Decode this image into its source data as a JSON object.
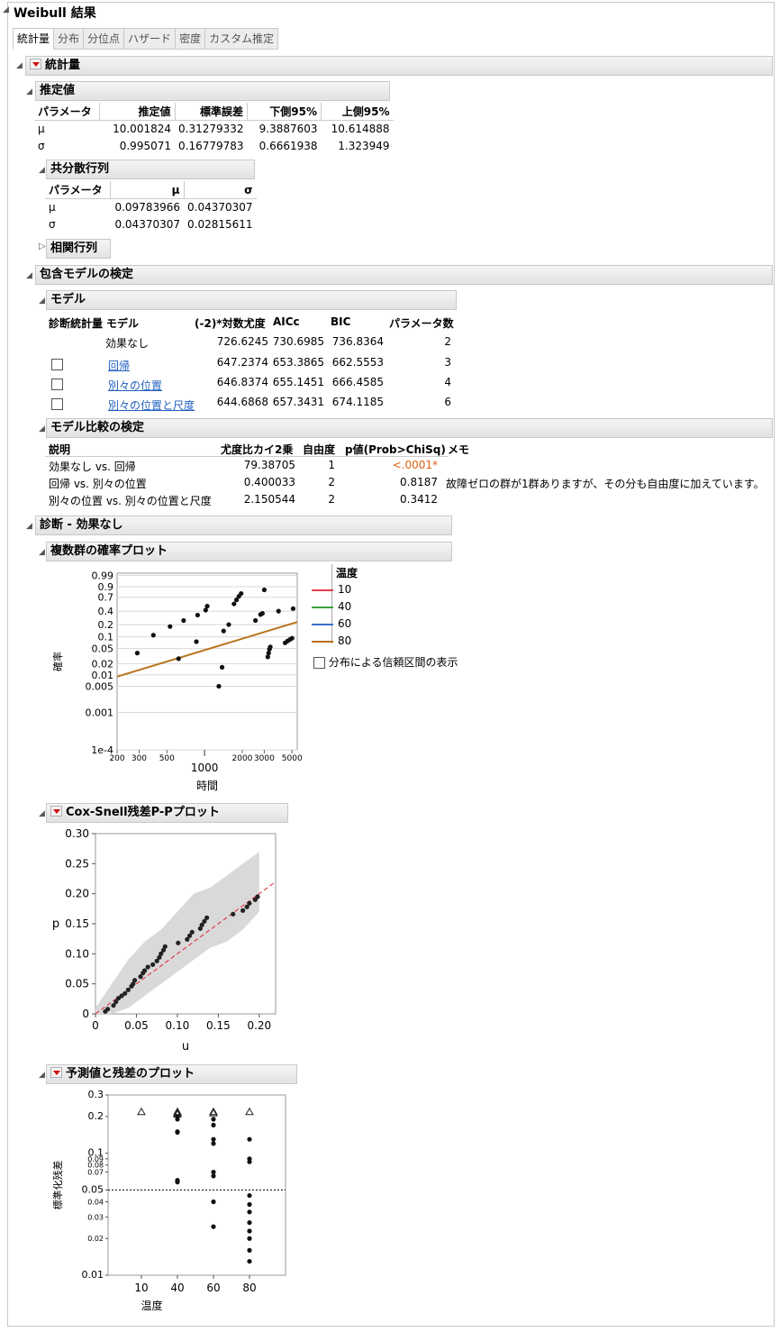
{
  "window": {
    "title": "Weibull 結果"
  },
  "tabs": [
    "統計量",
    "分布",
    "分位点",
    "ハザード",
    "密度",
    "カスタム推定"
  ],
  "statistics": {
    "title": "統計量",
    "estimates": {
      "title": "推定値",
      "headers": [
        "パラメータ",
        "推定値",
        "標準誤差",
        "下側95%",
        "上側95%"
      ],
      "rows": [
        [
          "μ",
          "10.001824",
          "0.31279332",
          "9.3887603",
          "10.614888"
        ],
        [
          "σ",
          "0.995071",
          "0.16779783",
          "0.6661938",
          "1.323949"
        ]
      ]
    },
    "covariance": {
      "title": "共分散行列",
      "headers": [
        "パラメータ",
        "μ",
        "σ"
      ],
      "rows": [
        [
          "μ",
          "0.09783966",
          "0.04370307"
        ],
        [
          "σ",
          "0.04370307",
          "0.02815611"
        ]
      ]
    },
    "correlation": {
      "title": "相関行列"
    }
  },
  "nested": {
    "title": "包含モデルの検定",
    "model": {
      "title": "モデル",
      "headers": [
        "診断統計量",
        "モデル",
        "(-2)*対数尤度",
        "AICc",
        "BIC",
        "パラメータ数"
      ],
      "rows": [
        {
          "name": "効果なし",
          "link": false,
          "ll": "726.6245",
          "aicc": "730.6985",
          "bic": "736.8364",
          "k": "2"
        },
        {
          "name": "回帰",
          "link": true,
          "ll": "647.2374",
          "aicc": "653.3865",
          "bic": "662.5553",
          "k": "3"
        },
        {
          "name": "別々の位置",
          "link": true,
          "ll": "646.8374",
          "aicc": "655.1451",
          "bic": "666.4585",
          "k": "4"
        },
        {
          "name": "別々の位置と尺度",
          "link": true,
          "ll": "644.6868",
          "aicc": "657.3431",
          "bic": "674.1185",
          "k": "6"
        }
      ]
    },
    "comparison": {
      "title": "モデル比較の検定",
      "headers": [
        "説明",
        "尤度比カイ2乗",
        "自由度",
        "p値(Prob>ChiSq)",
        "メモ"
      ],
      "rows": [
        [
          "効果なし vs. 回帰",
          "79.38705",
          "1",
          "<.0001*",
          ""
        ],
        [
          "回帰 vs. 別々の位置",
          "0.400033",
          "2",
          "0.8187",
          "故障ゼロの群が1群ありますが、その分も自由度に加えています。"
        ],
        [
          "別々の位置 vs. 別々の位置と尺度",
          "2.150544",
          "2",
          "0.3412",
          ""
        ]
      ]
    }
  },
  "diagnostics": {
    "title": "診断 - 効果なし",
    "prob_plot": {
      "title": "複数群の確率プロット",
      "xlabel": "時間",
      "ylabel": "確率",
      "legend_title": "温度",
      "legend": [
        {
          "label": "10",
          "color": "#e0404a"
        },
        {
          "label": "40",
          "color": "#3aa03a"
        },
        {
          "label": "60",
          "color": "#3a6fd0"
        },
        {
          "label": "80",
          "color": "#b8741a"
        }
      ],
      "checkbox_label": "分布による信頼区間の表示"
    },
    "coxsnell": {
      "title": "Cox-Snell残差P-Pプロット",
      "xlabel": "u",
      "ylabel": "p"
    },
    "residual": {
      "title": "予測値と残差のプロット",
      "xlabel": "温度",
      "ylabel": "標準化残差"
    }
  },
  "chart_data": [
    {
      "type": "scatter",
      "title": "複数群の確率プロット",
      "xlabel": "時間",
      "ylabel": "確率",
      "x_scale": "log",
      "x_ticks_minor": [
        "200",
        "300",
        "500",
        "2000",
        "3000",
        "5000"
      ],
      "x_ticks_major": [
        "1000"
      ],
      "xlim": [
        200,
        5500
      ],
      "y_scale": "weibull",
      "y_ticks": [
        "0.99",
        "0.9",
        "0.7",
        "0.4",
        "0.2",
        "0.1",
        "0.05",
        "0.02",
        "0.01",
        "0.005",
        "0.001",
        "1e-4"
      ],
      "line": {
        "name": "80",
        "x": [
          200,
          5500
        ],
        "y": [
          0.009,
          0.23
        ]
      },
      "points": [
        [
          290,
          0.038
        ],
        [
          390,
          0.11
        ],
        [
          530,
          0.18
        ],
        [
          620,
          0.027
        ],
        [
          680,
          0.25
        ],
        [
          860,
          0.075
        ],
        [
          880,
          0.33
        ],
        [
          1020,
          0.42
        ],
        [
          1050,
          0.5
        ],
        [
          1300,
          0.005
        ],
        [
          1380,
          0.016
        ],
        [
          1420,
          0.14
        ],
        [
          1560,
          0.2
        ],
        [
          1720,
          0.55
        ],
        [
          1800,
          0.64
        ],
        [
          1880,
          0.72
        ],
        [
          1960,
          0.78
        ],
        [
          2550,
          0.25
        ],
        [
          2800,
          0.34
        ],
        [
          2900,
          0.36
        ],
        [
          3000,
          0.85
        ],
        [
          3200,
          0.03
        ],
        [
          3250,
          0.038
        ],
        [
          3300,
          0.048
        ],
        [
          3350,
          0.055
        ],
        [
          3900,
          0.4
        ],
        [
          4400,
          0.07
        ],
        [
          4600,
          0.078
        ],
        [
          4800,
          0.085
        ],
        [
          5000,
          0.092
        ],
        [
          5100,
          0.45
        ]
      ],
      "legend_title": "温度",
      "legend": [
        "10",
        "40",
        "60",
        "80"
      ]
    },
    {
      "type": "scatter",
      "title": "Cox-Snell残差P-Pプロット",
      "xlabel": "u",
      "ylabel": "p",
      "xlim": [
        0,
        0.22
      ],
      "ylim": [
        0,
        0.3
      ],
      "x_ticks": [
        "0",
        "0.05",
        "0.10",
        "0.15",
        "0.20"
      ],
      "y_ticks": [
        "0",
        "0.05",
        "0.10",
        "0.15",
        "0.20",
        "0.25",
        "0.30"
      ],
      "reference_line": {
        "x": [
          0,
          0.22
        ],
        "y": [
          0,
          0.22
        ]
      },
      "band": {
        "x": [
          0.0,
          0.02,
          0.04,
          0.06,
          0.08,
          0.1,
          0.12,
          0.14,
          0.16,
          0.18,
          0.2
        ],
        "upper": [
          0.01,
          0.05,
          0.09,
          0.12,
          0.14,
          0.17,
          0.2,
          0.21,
          0.23,
          0.25,
          0.27
        ],
        "lower": [
          0.0,
          0.0,
          0.01,
          0.03,
          0.05,
          0.07,
          0.09,
          0.11,
          0.12,
          0.14,
          0.17
        ]
      },
      "points": [
        [
          0.012,
          0.004
        ],
        [
          0.015,
          0.008
        ],
        [
          0.022,
          0.014
        ],
        [
          0.025,
          0.02
        ],
        [
          0.028,
          0.026
        ],
        [
          0.032,
          0.03
        ],
        [
          0.036,
          0.034
        ],
        [
          0.04,
          0.04
        ],
        [
          0.044,
          0.046
        ],
        [
          0.046,
          0.05
        ],
        [
          0.048,
          0.056
        ],
        [
          0.055,
          0.062
        ],
        [
          0.058,
          0.068
        ],
        [
          0.06,
          0.072
        ],
        [
          0.064,
          0.078
        ],
        [
          0.07,
          0.082
        ],
        [
          0.075,
          0.088
        ],
        [
          0.078,
          0.094
        ],
        [
          0.08,
          0.1
        ],
        [
          0.083,
          0.106
        ],
        [
          0.085,
          0.112
        ],
        [
          0.101,
          0.118
        ],
        [
          0.112,
          0.124
        ],
        [
          0.115,
          0.13
        ],
        [
          0.118,
          0.136
        ],
        [
          0.128,
          0.142
        ],
        [
          0.13,
          0.148
        ],
        [
          0.133,
          0.154
        ],
        [
          0.136,
          0.16
        ],
        [
          0.168,
          0.166
        ],
        [
          0.18,
          0.172
        ],
        [
          0.185,
          0.178
        ],
        [
          0.188,
          0.184
        ],
        [
          0.195,
          0.19
        ],
        [
          0.198,
          0.195
        ]
      ]
    },
    {
      "type": "scatter",
      "title": "予測値と残差のプロット",
      "xlabel": "温度",
      "ylabel": "標準化残差",
      "x_ticks": [
        "10",
        "40",
        "60",
        "80"
      ],
      "y_scale": "log",
      "y_ticks": [
        "0.3",
        "0.2",
        "0.1",
        "0.09",
        "0.08",
        "0.07",
        "0.05",
        "0.04",
        "0.03",
        "0.02",
        "0.01"
      ],
      "reference_y": 0.05,
      "censored": [
        [
          10,
          0.22
        ],
        [
          40,
          0.22
        ],
        [
          40,
          0.215
        ],
        [
          40,
          0.21
        ],
        [
          60,
          0.22
        ],
        [
          60,
          0.215
        ],
        [
          80,
          0.22
        ]
      ],
      "points": [
        [
          40,
          0.2
        ],
        [
          40,
          0.19
        ],
        [
          40,
          0.15
        ],
        [
          40,
          0.148
        ],
        [
          40,
          0.06
        ],
        [
          40,
          0.058
        ],
        [
          60,
          0.19
        ],
        [
          60,
          0.17
        ],
        [
          60,
          0.13
        ],
        [
          60,
          0.12
        ],
        [
          60,
          0.07
        ],
        [
          60,
          0.065
        ],
        [
          60,
          0.04
        ],
        [
          60,
          0.025
        ],
        [
          80,
          0.13
        ],
        [
          80,
          0.09
        ],
        [
          80,
          0.085
        ],
        [
          80,
          0.045
        ],
        [
          80,
          0.038
        ],
        [
          80,
          0.033
        ],
        [
          80,
          0.027
        ],
        [
          80,
          0.023
        ],
        [
          80,
          0.02
        ],
        [
          80,
          0.016
        ],
        [
          80,
          0.013
        ]
      ]
    }
  ]
}
